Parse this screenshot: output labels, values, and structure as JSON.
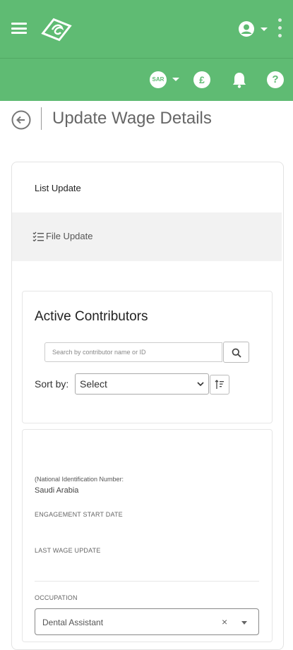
{
  "header": {
    "menu_icon": "hamburger-icon",
    "logo_icon": "gosi-logo",
    "user_icon": "account-circle-icon",
    "more_icon": "kebab-menu-icon",
    "brand_color": "#5fbb73"
  },
  "toolbar": {
    "currency_label": "SAR",
    "currency_icon": "currency-badge-icon",
    "coin_label": "£",
    "coin_icon": "coin-icon",
    "bell_icon": "bell-icon",
    "help_label": "?",
    "help_icon": "help-icon"
  },
  "page": {
    "title": "Update Wage Details",
    "back_icon": "back-arrow-icon"
  },
  "tabs": [
    {
      "label": "List Update"
    },
    {
      "label": "File Update",
      "icon": "checklist-icon"
    }
  ],
  "contributors": {
    "title": "Active Contributors",
    "search_placeholder": "Search by contributor name or ID",
    "sort_label": "Sort by:",
    "sort_value": "Select",
    "sort_order_icon": "sort-order-icon"
  },
  "contributor_card": {
    "id_label": "(National Identification Number:",
    "nationality": "Saudi Arabia",
    "engagement_label": "ENGAGEMENT START DATE",
    "last_wage_label": "LAST WAGE UPDATE",
    "occupation_label": "OCCUPATION",
    "occupation_value": "Dental Assistant",
    "clear_symbol": "×"
  }
}
